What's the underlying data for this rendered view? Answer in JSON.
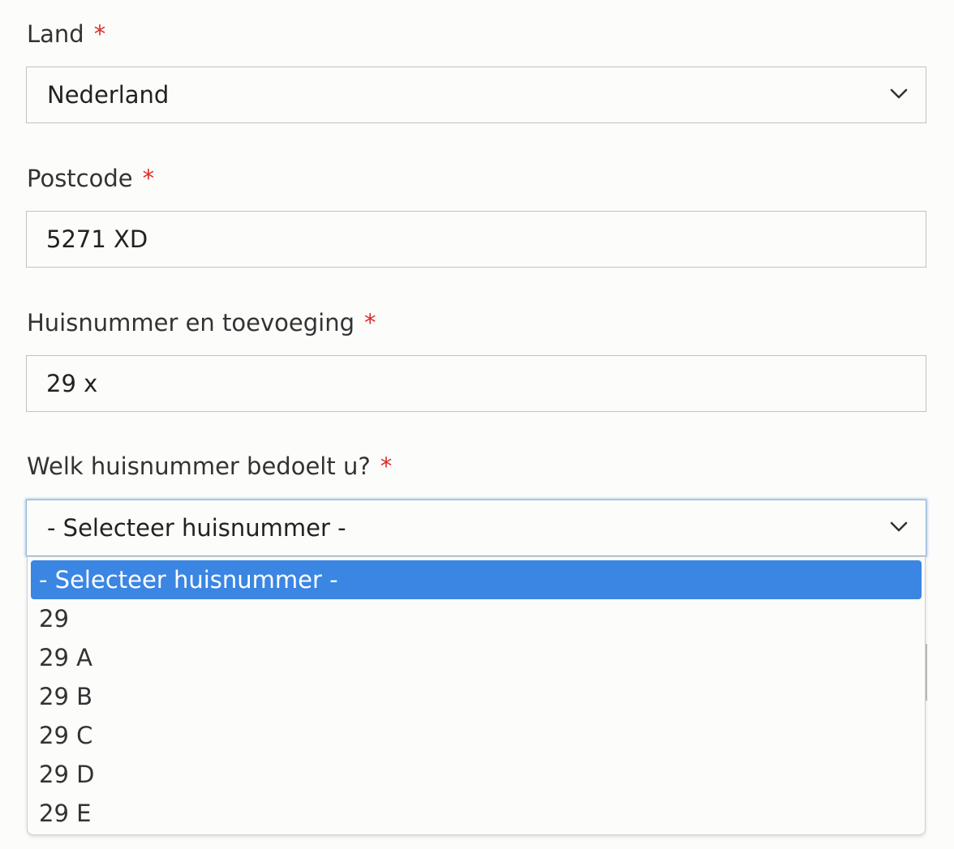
{
  "form": {
    "country": {
      "label": "Land",
      "required_mark": "*",
      "value": "Nederland"
    },
    "postcode": {
      "label": "Postcode",
      "required_mark": "*",
      "value": "5271 XD"
    },
    "house_number": {
      "label": "Huisnummer en toevoeging",
      "required_mark": "*",
      "value": "29 x"
    },
    "house_number_choice": {
      "label": "Welk huisnummer bedoelt u?",
      "required_mark": "*",
      "value": "- Selecteer huisnummer -",
      "options": [
        "- Selecteer huisnummer -",
        "29",
        "29 A",
        "29 B",
        "29 C",
        "29 D",
        "29 E"
      ],
      "highlighted_option": "- Selecteer huisnummer -"
    }
  },
  "colors": {
    "required": "#e02b27",
    "highlight": "#3a86e2",
    "border": "#c2c2c2",
    "focus": "#8fb6da"
  },
  "icons": {
    "select_arrow": "chevron-down-icon"
  }
}
